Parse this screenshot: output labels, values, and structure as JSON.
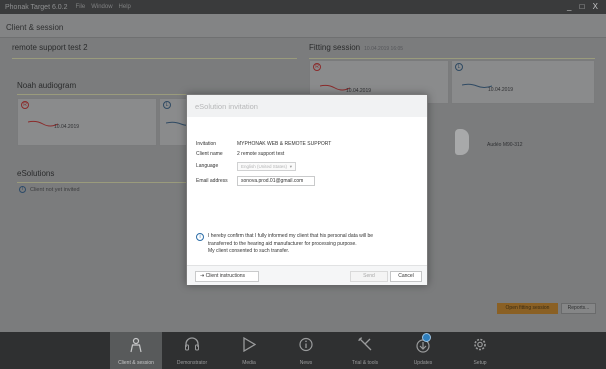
{
  "titlebar": {
    "app_name": "Phonak Target 6.0.2",
    "menus": [
      "File",
      "Window",
      "Help"
    ],
    "window_controls": "_ □ X"
  },
  "header": {
    "title": "Client & session"
  },
  "client": {
    "name": "remote support test  2"
  },
  "fitting": {
    "label": "Fitting session",
    "date": "10.04.2019 16:05"
  },
  "noah": {
    "title": "Noah audiogram",
    "right_label": "R",
    "left_label": "L",
    "right_date": "10.04.2019"
  },
  "fitting_cards": {
    "right_label": "R",
    "left_label": "L",
    "right_date": "10.04.2019",
    "left_date": "10.04.2019"
  },
  "device": {
    "name": "Audéo M90-312"
  },
  "esolutions": {
    "title": "eSolutions",
    "status": "Client not yet invited"
  },
  "modal": {
    "title": "eSolution invitation",
    "invitation_key": "Invitation",
    "invitation_value": "MYPHONAK WEB & REMOTE SUPPORT",
    "client_name_key": "Client name",
    "client_name_value": "2 remote support test",
    "language_key": "Language",
    "language_value": "English (United States)",
    "email_key": "Email address",
    "email_value": "sonova.prod.01@gmail.com",
    "consent_line1": "I hereby confirm that I fully informed my client that his personal data will be",
    "consent_line2": "transferred to the hearing aid manufacturer for processing purpose.",
    "consent_line3": "My client consented to such transfer.",
    "instructions_label": "Client instructions",
    "send_label": "Send",
    "cancel_label": "Cancel"
  },
  "actions": {
    "open_fitting": "Open fitting session",
    "reports": "Reports..."
  },
  "nav": [
    {
      "label": "Client & session",
      "icon": "person-icon",
      "active": true
    },
    {
      "label": "Demonstrator",
      "icon": "headphones-icon"
    },
    {
      "label": "Media",
      "icon": "play-icon"
    },
    {
      "label": "News",
      "icon": "info-icon"
    },
    {
      "label": "Trial & tools",
      "icon": "tools-icon"
    },
    {
      "label": "Updates",
      "icon": "download-icon"
    },
    {
      "label": "Setup",
      "icon": "gear-icon"
    }
  ],
  "colors": {
    "accent_orange": "#e08a1e",
    "right_ear": "#c0392b",
    "left_ear": "#3a6a94",
    "nav_bg": "#2f3031"
  }
}
